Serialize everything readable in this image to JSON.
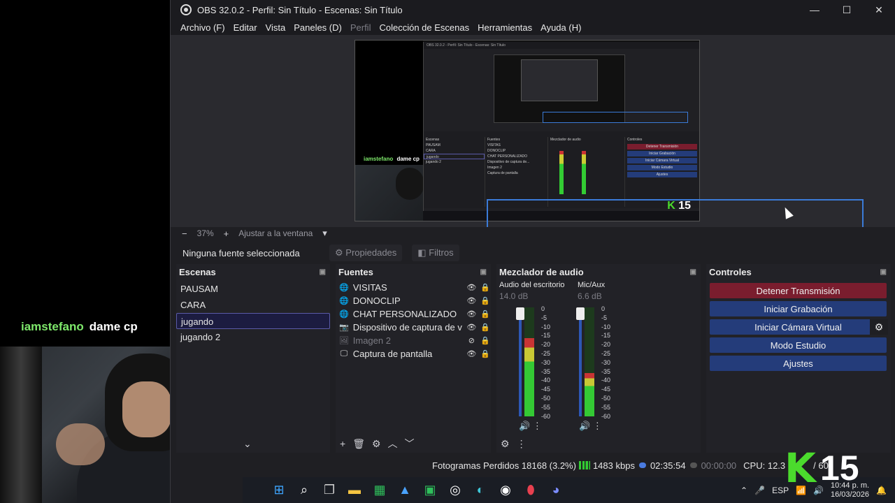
{
  "overlay": {
    "chat_user": "iamstefano",
    "chat_message": "dame cp"
  },
  "window": {
    "title": "OBS 32.0.2 - Perfil: Sin Título - Escenas: Sin Título",
    "minimize": "—",
    "maximize": "☐",
    "close": "✕"
  },
  "menu": [
    {
      "label": "Archivo (F)",
      "disabled": false
    },
    {
      "label": "Editar",
      "disabled": false
    },
    {
      "label": "Vista",
      "disabled": false
    },
    {
      "label": "Paneles (D)",
      "disabled": false
    },
    {
      "label": "Perfil",
      "disabled": true
    },
    {
      "label": "Colección de Escenas",
      "disabled": false
    },
    {
      "label": "Herramientas",
      "disabled": false
    },
    {
      "label": "Ayuda (H)",
      "disabled": false
    }
  ],
  "zoom": {
    "minus": "−",
    "value": "37%",
    "plus": "+",
    "fit_label": "Ajustar a la ventana",
    "dropdown": "▾"
  },
  "context": {
    "no_source": "Ninguna fuente seleccionada",
    "properties": "Propiedades",
    "filters": "Filtros"
  },
  "scenes": {
    "title": "Escenas",
    "items": [
      {
        "label": "PAUSAM",
        "selected": false
      },
      {
        "label": "CARA",
        "selected": false
      },
      {
        "label": "jugando",
        "selected": true
      },
      {
        "label": "jugando 2",
        "selected": false
      }
    ],
    "collapse": "⌄"
  },
  "sources": {
    "title": "Fuentes",
    "items": [
      {
        "label": "VISITAS",
        "icon": "globe-icon",
        "visible": true
      },
      {
        "label": "DONOCLIP",
        "icon": "globe-icon",
        "visible": true
      },
      {
        "label": "CHAT PERSONALIZADO",
        "icon": "globe-icon",
        "visible": true
      },
      {
        "label": "Dispositivo de captura de vídeo",
        "icon": "camera-icon",
        "visible": true
      },
      {
        "label": "Imagen 2",
        "icon": "image-icon",
        "visible": false
      },
      {
        "label": "Captura de pantalla",
        "icon": "monitor-icon",
        "visible": true
      }
    ],
    "footer": [
      "+",
      "🗑",
      "⚙",
      "︿",
      "﹀"
    ]
  },
  "mixer": {
    "title": "Mezclador de audio",
    "channels": [
      {
        "name": "Audio del escritorio",
        "db": "14.0 dB",
        "level": 0.72
      },
      {
        "name": "Mic/Aux",
        "db": "6.6 dB",
        "level": 0.4
      }
    ],
    "scale": [
      "0",
      "-5",
      "-10",
      "-15",
      "-20",
      "-25",
      "-30",
      "-35",
      "-40",
      "-45",
      "-50",
      "-55",
      "-60"
    ]
  },
  "controls": {
    "title": "Controles",
    "buttons": [
      {
        "label": "Detener Transmisión",
        "style": "stop"
      },
      {
        "label": "Iniciar Grabación",
        "style": "normal"
      },
      {
        "label": "Iniciar Cámara Virtual",
        "style": "normal"
      },
      {
        "label": "Modo Estudio",
        "style": "normal"
      },
      {
        "label": "Ajustes",
        "style": "normal"
      }
    ]
  },
  "status": {
    "dropped": "Fotogramas Perdidos 18168 (3.2%)",
    "bitrate": "1483 kbps",
    "stream_time": "02:35:54",
    "record_time": "00:00:00",
    "cpu": "CPU: 12.3",
    "fps": "/ 60"
  },
  "taskbar": {
    "lang": "ESP",
    "time": "10:44 p. m.",
    "date": "16/03/2026"
  },
  "nested": {
    "chat_user": "iamstefano",
    "chat_message": "dame cp",
    "scenes": [
      "PAUSAM",
      "CARA",
      "jugando",
      "jugando 2"
    ],
    "sources": [
      "VISITAS",
      "DONOCLIP",
      "CHAT PERSONALIZADO",
      "Dispositivo de captura de...",
      "Imagen 2",
      "Captura de pantalla"
    ],
    "buttons": [
      "Detener Transmisión",
      "Iniciar Grabación",
      "Iniciar Cámara Virtual",
      "Modo Estudio",
      "Ajustes"
    ]
  },
  "k_logo": {
    "letter": "K",
    "number": "15"
  },
  "colors": {
    "accent": "#243c7a",
    "stop": "#7a1d2e",
    "chat_user": "#7ee86b",
    "selection": "#3b7bd8"
  }
}
